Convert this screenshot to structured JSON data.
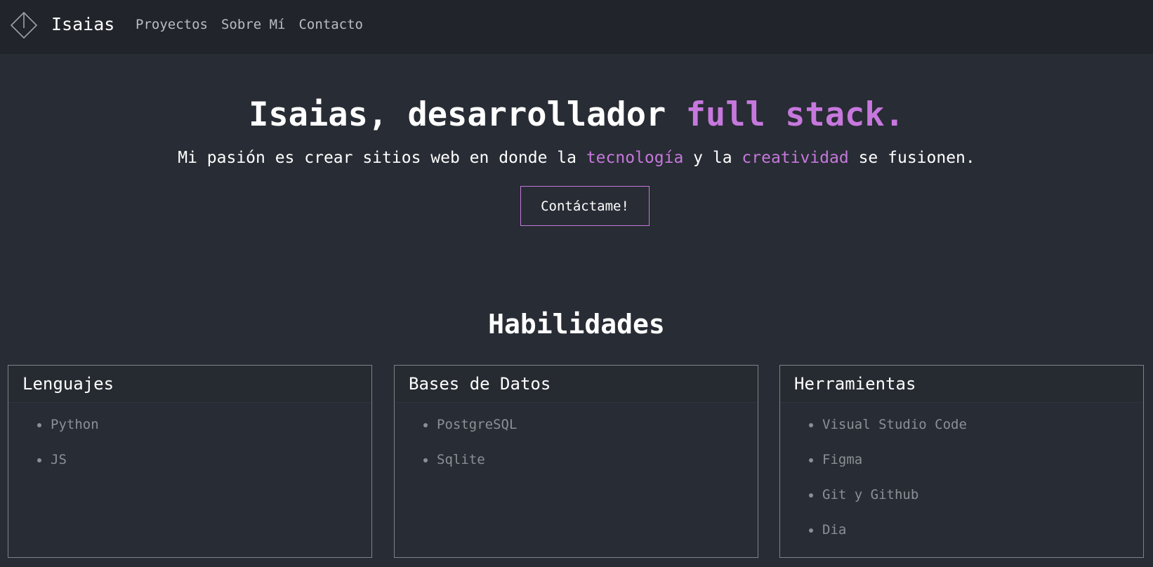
{
  "navbar": {
    "brand": "Isaias",
    "links": [
      "Proyectos",
      "Sobre Mí",
      "Contacto"
    ]
  },
  "hero": {
    "title_main": "Isaias, desarrollador ",
    "title_accent": "full stack.",
    "subtitle_part1": "Mi pasión es crear sitios web en donde la ",
    "subtitle_accent1": "tecnología",
    "subtitle_part2": " y la ",
    "subtitle_accent2": "creatividad",
    "subtitle_part3": " se fusionen.",
    "cta_label": "Contáctame!"
  },
  "skills": {
    "title": "Habilidades",
    "cards": [
      {
        "title": "Lenguajes",
        "items": [
          "Python",
          "JS"
        ]
      },
      {
        "title": "Bases de Datos",
        "items": [
          "PostgreSQL",
          "Sqlite"
        ]
      },
      {
        "title": "Herramientas",
        "items": [
          "Visual Studio Code",
          "Figma",
          "Git y Github",
          "Dia"
        ]
      }
    ]
  },
  "colors": {
    "background": "#282c34",
    "navbar": "#21252b",
    "accent": "#c678dd",
    "muted_text": "#8b8f96"
  },
  "icons": {
    "logo": "diamond-logo-icon"
  }
}
